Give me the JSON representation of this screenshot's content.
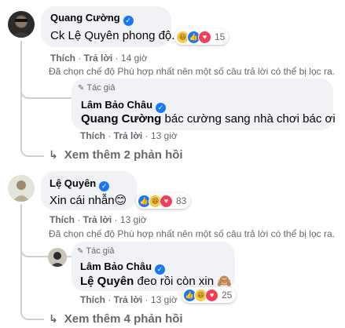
{
  "comments": [
    {
      "author": "Quang Cường",
      "text": "Ck Lệ Quyên phong độ.",
      "reaction_count": "15",
      "actions": {
        "like": "Thích",
        "reply": "Trả lời",
        "time": "14 giờ"
      },
      "filter_note": "Đã chọn chế độ Phù hợp nhất nên một số câu trả lời có thể bị lọc ra.",
      "reply": {
        "author_tag": "Tác giả",
        "author": "Lâm Bảo Châu",
        "mention": "Quang Cường",
        "text": " bác cường sang nhà chơi bác ơi",
        "actions": {
          "like": "Thích",
          "reply": "Trả lời",
          "time": "13 giờ"
        }
      },
      "more_replies": "Xem thêm 2 phản hồi"
    },
    {
      "author": "Lệ Quyên",
      "text": "Xin cái nhẫn😊",
      "reaction_count": "83",
      "actions": {
        "like": "Thích",
        "reply": "Trả lời",
        "time": "13 giờ"
      },
      "filter_note": "Đã chọn chế độ Phù hợp nhất nên một số câu trả lời có thể bị lọc ra.",
      "reply": {
        "author_tag": "Tác giả",
        "author": "Lâm Bảo Châu",
        "mention": "Lệ Quyên",
        "text": " đeo rồi còn xin 🙈",
        "reaction_count": "25",
        "actions": {
          "like": "Thích",
          "reply": "Trả lời",
          "time": "13 giờ"
        }
      },
      "more_replies": "Xem thêm 4 phản hồi"
    }
  ],
  "colors": {
    "verified": "#1877f2",
    "bubble": "#f0f2f5",
    "muted": "#65676b"
  },
  "icons": [
    "verified-badge-icon",
    "haha-reaction-icon",
    "like-reaction-icon",
    "love-reaction-icon",
    "pen-icon",
    "reply-arrow-icon"
  ]
}
